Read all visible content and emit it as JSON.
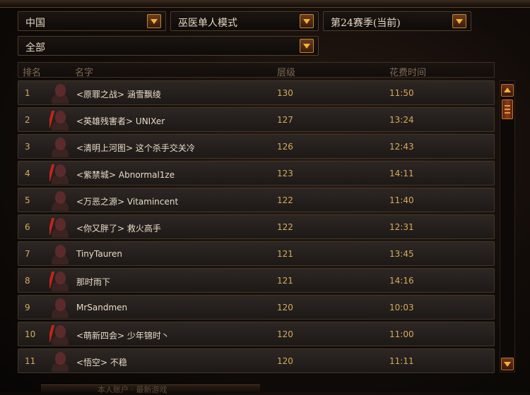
{
  "filters": {
    "region": "中国",
    "mode": "巫医单人模式",
    "season": "第24赛季(当前)",
    "scope": "全部"
  },
  "columns": {
    "rank": "排名",
    "name": "名字",
    "level": "层级",
    "time": "花费时间"
  },
  "rows": [
    {
      "rank": "1",
      "name": "<原罪之战> 涵雪飘绫",
      "level": "130",
      "time": "11:50"
    },
    {
      "rank": "2",
      "name": "<英雄残害者> UNIXer",
      "level": "127",
      "time": "13:24"
    },
    {
      "rank": "3",
      "name": "<清明上河图> 这个杀手交关冷",
      "level": "126",
      "time": "12:43"
    },
    {
      "rank": "4",
      "name": "<紫禁城> Abnormal1ze",
      "level": "123",
      "time": "14:11"
    },
    {
      "rank": "5",
      "name": "<万恶之源> Vitamincent",
      "level": "122",
      "time": "11:40"
    },
    {
      "rank": "6",
      "name": "<你又胖了> 救火高手",
      "level": "122",
      "time": "12:31"
    },
    {
      "rank": "7",
      "name": "TinyTauren",
      "level": "121",
      "time": "13:45"
    },
    {
      "rank": "8",
      "name": "那时雨下",
      "level": "121",
      "time": "14:16"
    },
    {
      "rank": "9",
      "name": "MrSandmen",
      "level": "120",
      "time": "10:03"
    },
    {
      "rank": "10",
      "name": "<萌新四会> 少年锦时丶",
      "level": "120",
      "time": "11:00"
    },
    {
      "rank": "11",
      "name": "<悟空> 不稳",
      "level": "120",
      "time": "11:11"
    }
  ],
  "footer_text": "本人账户 · 最新游戏",
  "colors": {
    "accent": "#f6b23c",
    "value": "#d6ab5a",
    "text": "#e8dcc7"
  },
  "icons": {
    "dropdown": "chevron-down-icon",
    "scroll_up": "arrow-up-icon",
    "scroll_down": "arrow-down-icon",
    "portrait": "witch-doctor-portrait-icon"
  }
}
